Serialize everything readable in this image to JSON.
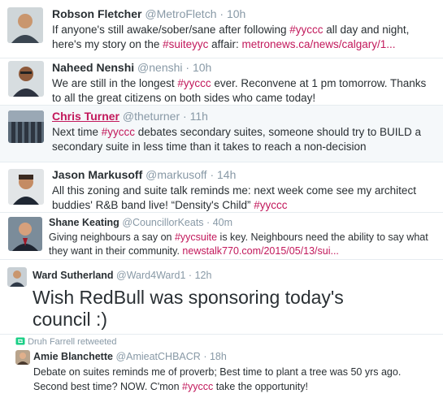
{
  "tweets": [
    {
      "name": "Robson Fletcher",
      "handle": "@MetroFletch",
      "time": "10h",
      "segments": [
        {
          "t": "If anyone's still awake/sober/sane after following ",
          "k": "text"
        },
        {
          "t": "#yyccc",
          "k": "hash"
        },
        {
          "t": " all day and night, here's my story on the ",
          "k": "text"
        },
        {
          "t": "#suiteyyc",
          "k": "hash"
        },
        {
          "t": " affair: ",
          "k": "text"
        },
        {
          "t": "metronews.ca/news/calgary/1...",
          "k": "link"
        }
      ]
    },
    {
      "name": "Naheed Nenshi",
      "handle": "@nenshi",
      "time": "10h",
      "segments": [
        {
          "t": "We are still in the longest ",
          "k": "text"
        },
        {
          "t": "#yyccc",
          "k": "hash"
        },
        {
          "t": " ever. Reconvene at 1 pm tomorrow. Thanks to all the great citizens on both sides who came today!",
          "k": "text"
        }
      ]
    },
    {
      "name": "Chris Turner",
      "handle": "@theturner",
      "time": "11h",
      "segments": [
        {
          "t": "Next time ",
          "k": "text"
        },
        {
          "t": "#yyccc",
          "k": "hash"
        },
        {
          "t": " debates secondary suites, someone should try to BUILD a secondary suite in less time than it takes to reach a non-decision",
          "k": "text"
        }
      ]
    },
    {
      "name": "Jason Markusoff",
      "handle": "@markusoff",
      "time": "14h",
      "segments": [
        {
          "t": "All this zoning and suite talk reminds me: next week come see my architect buddies' R&B band live! “Density's Child” ",
          "k": "text"
        },
        {
          "t": "#yyccc",
          "k": "hash"
        }
      ]
    },
    {
      "name": "Shane Keating",
      "handle": "@CouncillorKeats",
      "time": "40m",
      "segments": [
        {
          "t": "Giving neighbours a say on ",
          "k": "text"
        },
        {
          "t": "#yycsuite",
          "k": "hash"
        },
        {
          "t": " is key.  Neighbours need the ability to say what they want in their community. ",
          "k": "text"
        },
        {
          "t": "newstalk770.com/2015/05/13/sui...",
          "k": "link"
        }
      ]
    },
    {
      "name": "Ward Sutherland",
      "handle": "@Ward4Ward1",
      "time": "12h",
      "segments": [
        {
          "t": "Wish RedBull was sponsoring today's council :)",
          "k": "text"
        }
      ]
    },
    {
      "retweet_label": "Druh Farrell retweeted",
      "name": "Amie Blanchette",
      "handle": "@AmieatCHBACR",
      "time": "18h",
      "segments": [
        {
          "t": "Debate on suites reminds me of proverb; Best time to plant a tree was 50 yrs ago. Second best time? NOW. C'mon ",
          "k": "text"
        },
        {
          "t": "#yyccc",
          "k": "hash"
        },
        {
          "t": " take the opportunity!",
          "k": "text"
        }
      ]
    }
  ],
  "separator": "·",
  "retweet_icon": "retweet-icon",
  "colors": {
    "hashtag": "#c2185b",
    "name": "#292f33",
    "meta": "#8899a6",
    "highlight_name": "#c2185b",
    "retweet": "#19cf86"
  }
}
